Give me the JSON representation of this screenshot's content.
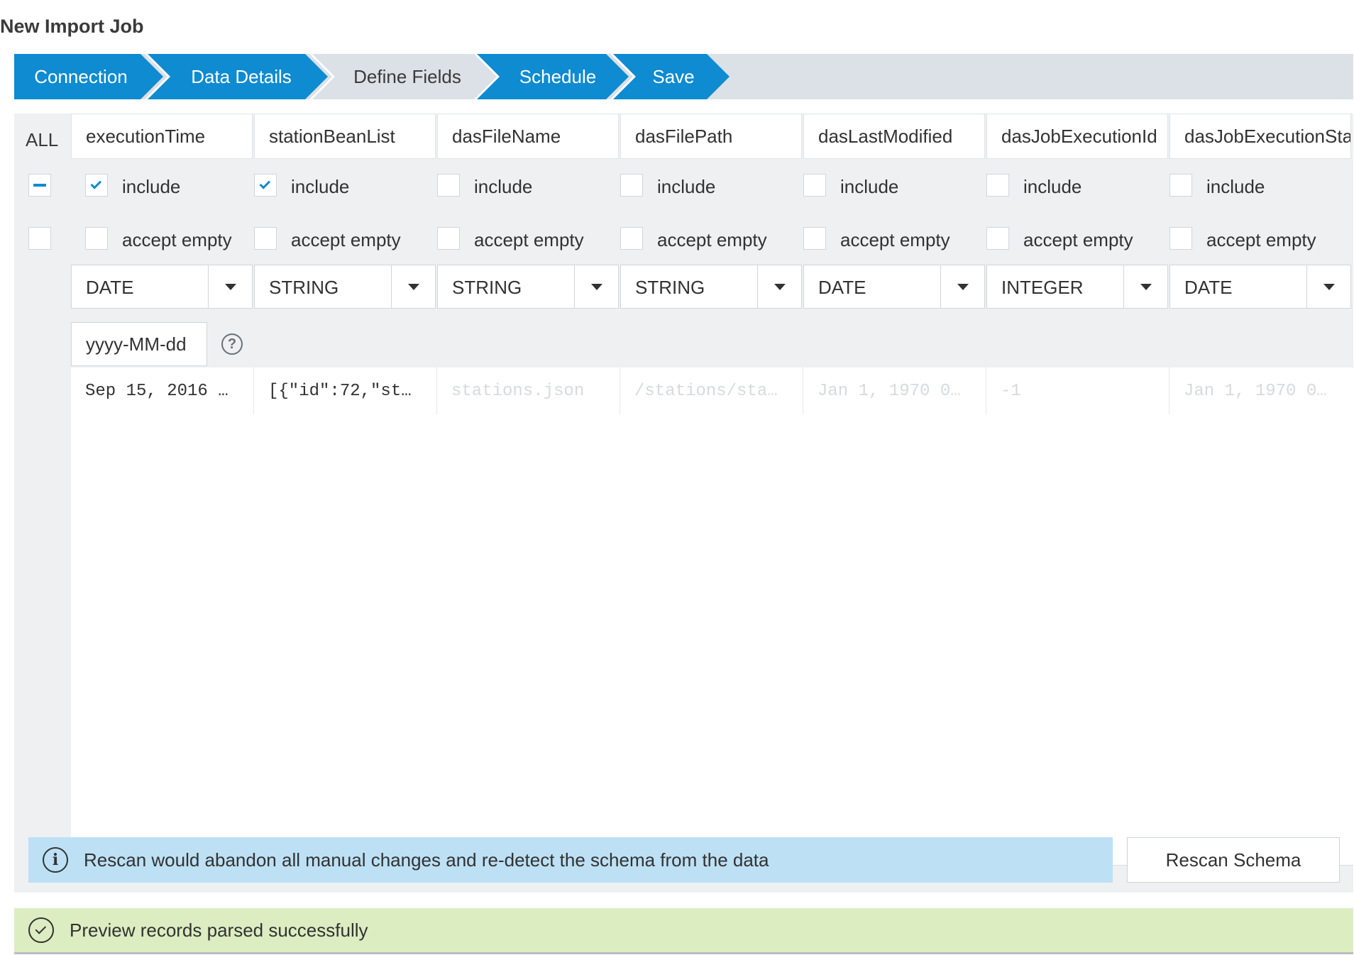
{
  "page": {
    "title": "New Import Job"
  },
  "wizard": {
    "steps": [
      {
        "label": "Connection",
        "state": "active"
      },
      {
        "label": "Data Details",
        "state": "active"
      },
      {
        "label": "Define Fields",
        "state": "current"
      },
      {
        "label": "Schedule",
        "state": "active"
      },
      {
        "label": "Save",
        "state": "active"
      }
    ]
  },
  "fields": {
    "all_label": "ALL",
    "all_include_state": "partial",
    "all_accept_empty_checked": false,
    "include_label": "include",
    "accept_empty_label": "accept empty",
    "columns": [
      {
        "name": "executionTime",
        "include": true,
        "accept_empty": false,
        "type": "DATE",
        "preview": "Sep 15, 2016 …"
      },
      {
        "name": "stationBeanList",
        "include": true,
        "accept_empty": false,
        "type": "STRING",
        "preview": "[{\"id\":72,\"st…"
      },
      {
        "name": "dasFileName",
        "include": false,
        "accept_empty": false,
        "type": "STRING",
        "preview": "stations.json"
      },
      {
        "name": "dasFilePath",
        "include": false,
        "accept_empty": false,
        "type": "STRING",
        "preview": "/stations/sta…"
      },
      {
        "name": "dasLastModified",
        "include": false,
        "accept_empty": false,
        "type": "DATE",
        "preview": "Jan 1, 1970 0…"
      },
      {
        "name": "dasJobExecutionId",
        "include": false,
        "accept_empty": false,
        "type": "INTEGER",
        "preview": "-1"
      },
      {
        "name": "dasJobExecutionStart",
        "include": false,
        "accept_empty": false,
        "type": "DATE",
        "preview": "Jan 1, 1970 0…"
      }
    ],
    "date_format_value": "yyyy-MM-dd"
  },
  "info": {
    "message": "Rescan would abandon all manual changes and re-detect the schema from the data",
    "rescan_label": "Rescan Schema"
  },
  "status": {
    "success_message": "Preview records parsed successfully"
  },
  "colors": {
    "accent": "#0f8bd1",
    "info_bg": "#bde0f4",
    "success_bg": "#dcedc1",
    "wizard_bg": "#dbe1e6"
  }
}
